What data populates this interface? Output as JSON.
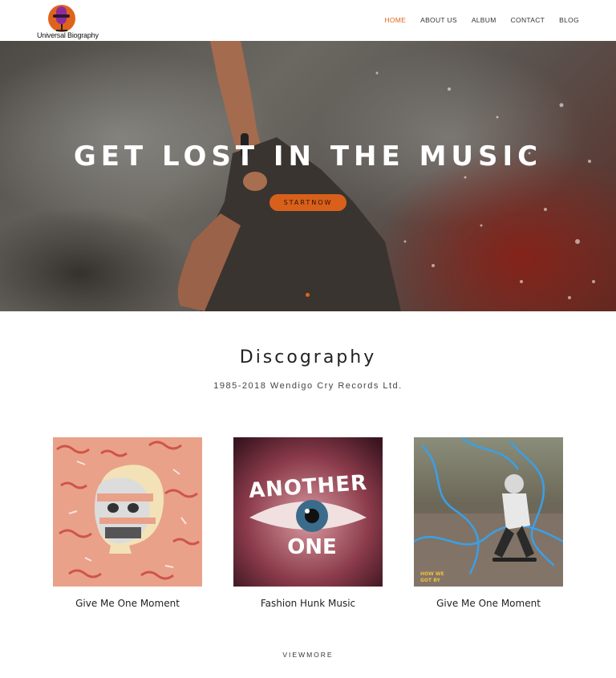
{
  "brand": {
    "logo_text": "Universal Biography"
  },
  "nav": {
    "items": [
      {
        "label": "HOME",
        "active": true
      },
      {
        "label": "ABOUT US",
        "active": false
      },
      {
        "label": "ALBUM",
        "active": false
      },
      {
        "label": "CONTACT",
        "active": false
      },
      {
        "label": "BLOG",
        "active": false
      }
    ]
  },
  "hero": {
    "title": "GET LOST IN THE MUSIC",
    "button_label": "STARTNOW"
  },
  "discography": {
    "title": "Discography",
    "subtitle": "1985-2018 Wendigo Cry Records Ltd.",
    "albums": [
      {
        "name": "Give Me One Moment"
      },
      {
        "name": "Fashion Hunk Music",
        "cover_text": "ANOTHER ONE"
      },
      {
        "name": "Give Me One Moment",
        "cover_text": "HOW WE GOT BY"
      }
    ],
    "view_more": "VIEWMORE"
  },
  "colors": {
    "accent": "#e0631c",
    "hero_button": "#d9601b",
    "text": "#222222"
  }
}
